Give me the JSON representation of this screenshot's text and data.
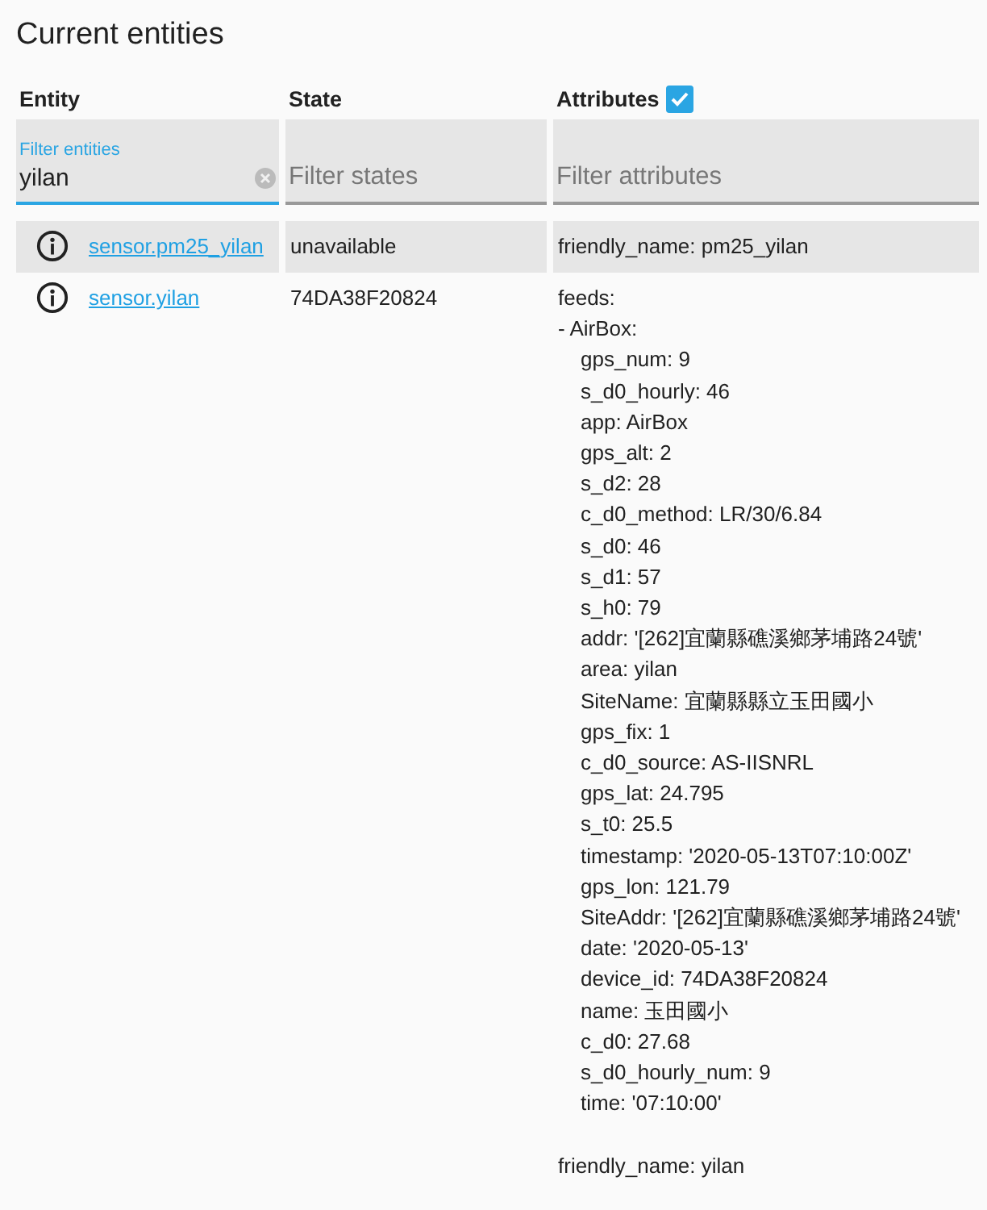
{
  "title": "Current entities",
  "columns": [
    {
      "label": "Entity"
    },
    {
      "label": "State"
    },
    {
      "label": "Attributes",
      "kind": "checkbox",
      "checked": true
    }
  ],
  "filters": [
    {
      "label": "Filter entities",
      "value": "yilan",
      "focused": true
    },
    {
      "placeholder": "Filter states",
      "focused": false
    },
    {
      "placeholder": "Filter attributes",
      "focused": false
    }
  ],
  "rows": [
    {
      "entity": "sensor.pm25_yilan",
      "state": "unavailable",
      "attributes": [
        {
          "text": "friendly_name: pm25_yilan"
        }
      ]
    },
    {
      "entity": "sensor.yilan",
      "state": "74DA38F20824",
      "attributes": [
        {
          "text": "feeds:",
          "children": [
            {
              "text": "- AirBox:",
              "children": [
                {
                  "text": "gps_num: 9"
                },
                {
                  "text": "s_d0_hourly: 46"
                },
                {
                  "text": "app: AirBox"
                },
                {
                  "text": "gps_alt: 2"
                },
                {
                  "text": "s_d2: 28"
                },
                {
                  "text": "c_d0_method: LR/30/6.84"
                },
                {
                  "text": "s_d0: 46"
                },
                {
                  "text": "s_d1: 57"
                },
                {
                  "text": "s_h0: 79"
                },
                {
                  "text": "addr: '[262]宜蘭縣礁溪鄉茅埔路24號'"
                },
                {
                  "text": "area: yilan"
                },
                {
                  "text": "SiteName: 宜蘭縣縣立玉田國小"
                },
                {
                  "text": "gps_fix: 1"
                },
                {
                  "text": "c_d0_source: AS-IISNRL"
                },
                {
                  "text": "gps_lat: 24.795"
                },
                {
                  "text": "s_t0: 25.5"
                },
                {
                  "text": "timestamp: '2020-05-13T07:10:00Z'"
                },
                {
                  "text": "gps_lon: 121.79"
                },
                {
                  "text": "SiteAddr: '[262]宜蘭縣礁溪鄉茅埔路24號'"
                },
                {
                  "text": "date: '2020-05-13'"
                },
                {
                  "text": "device_id: 74DA38F20824"
                },
                {
                  "text": "name: 玉田國小"
                },
                {
                  "text": "c_d0: 27.68"
                },
                {
                  "text": "s_d0_hourly_num: 9"
                },
                {
                  "text": "time: '07:10:00'"
                }
              ]
            }
          ]
        },
        {
          "text": "friendly_name: yilan"
        }
      ]
    }
  ]
}
